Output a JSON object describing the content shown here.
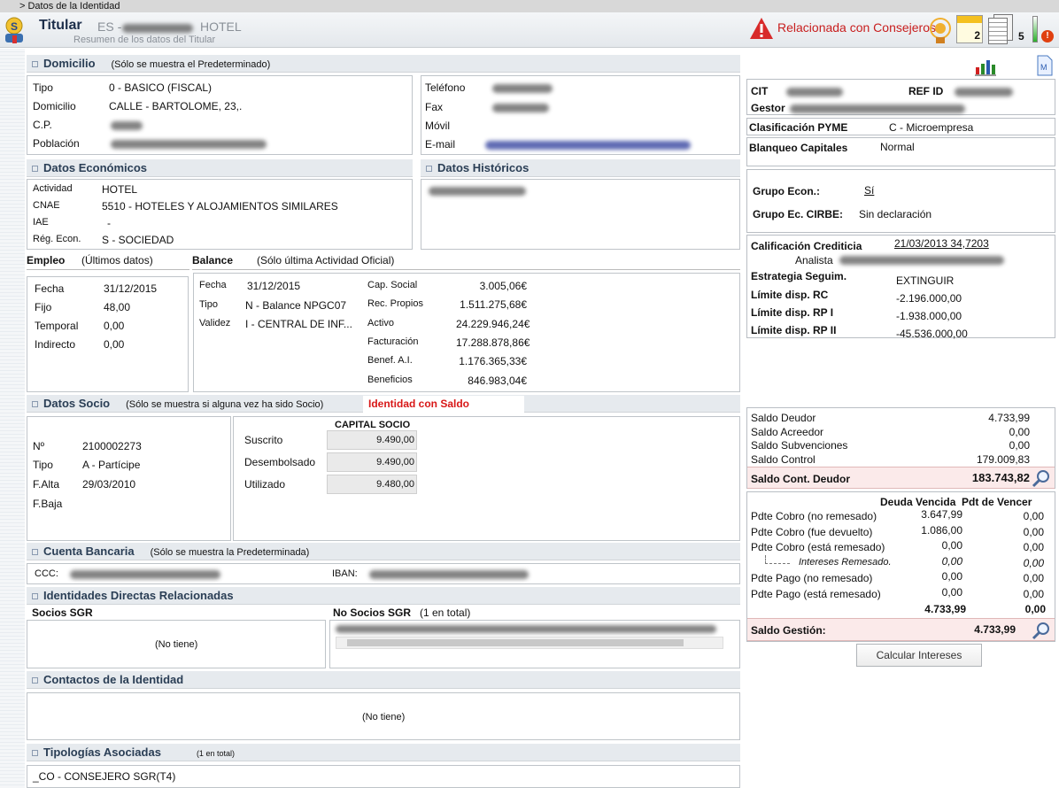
{
  "breadcrumb": "> Datos de la Identidad",
  "header": {
    "title": "Titular",
    "id_prefix": "ES -",
    "entity_name": "HOTEL",
    "subtitle": "Resumen de los datos del Titular",
    "alert_text": "Relacionada con Consejeros",
    "badge_notes": "2",
    "badge_docs": "5"
  },
  "domicilio": {
    "title": "Domicilio",
    "note": "(Sólo se muestra el Predeterminado)",
    "tipo_label": "Tipo",
    "tipo_value": "0 - BASICO (FISCAL)",
    "dom_label": "Domicilio",
    "dom_value": "CALLE - BARTOLOME, 23,.",
    "cp_label": "C.P.",
    "pob_label": "Población",
    "tel_label": "Teléfono",
    "fax_label": "Fax",
    "movil_label": "Móvil",
    "email_label": "E-mail"
  },
  "economicos": {
    "title": "Datos Económicos",
    "actividad_label": "Actividad",
    "actividad_value": "HOTEL",
    "cnae_label": "CNAE",
    "cnae_value": "5510 - HOTELES Y ALOJAMIENTOS SIMILARES",
    "iae_label": "IAE",
    "iae_value": "-",
    "reg_label": "Rég. Econ.",
    "reg_value": "S - SOCIEDAD"
  },
  "historicos": {
    "title": "Datos Históricos"
  },
  "empleo": {
    "title": "Empleo",
    "note": "(Últimos datos)",
    "rows": [
      {
        "label": "Fecha",
        "value": "31/12/2015"
      },
      {
        "label": "Fijo",
        "value": "48,00"
      },
      {
        "label": "Temporal",
        "value": "0,00"
      },
      {
        "label": "Indirecto",
        "value": "0,00"
      }
    ]
  },
  "balance": {
    "title": "Balance",
    "note": "(Sólo última Actividad Oficial)",
    "fecha_label": "Fecha",
    "fecha_value": "31/12/2015",
    "tipo_label": "Tipo",
    "tipo_value": "N - Balance NPGC07",
    "validez_label": "Validez",
    "validez_value": "I - CENTRAL DE INF...",
    "rows": [
      {
        "label": "Cap. Social",
        "value": "3.005,06€"
      },
      {
        "label": "Rec. Propios",
        "value": "1.511.275,68€"
      },
      {
        "label": "Activo",
        "value": "24.229.946,24€"
      },
      {
        "label": "Facturación",
        "value": "17.288.878,86€"
      },
      {
        "label": "Benef. A.I.",
        "value": "1.176.365,33€"
      },
      {
        "label": "Beneficios",
        "value": "846.983,04€"
      }
    ]
  },
  "socio": {
    "title": "Datos Socio",
    "note": "(Sólo se muestra si alguna vez ha sido Socio)",
    "blocked": "Identidad con Saldo Bloqueado",
    "num_label": "Nº",
    "num_value": "2100002273",
    "tipo_label": "Tipo",
    "tipo_value": "A - Partícipe",
    "alta_label": "F.Alta",
    "alta_value": "29/03/2010",
    "baja_label": "F.Baja",
    "capital_title": "CAPITAL SOCIO",
    "capital": [
      {
        "label": "Suscrito",
        "value": "9.490,00"
      },
      {
        "label": "Desembolsado",
        "value": "9.490,00"
      },
      {
        "label": "Utilizado",
        "value": "9.480,00"
      }
    ]
  },
  "cuenta": {
    "title": "Cuenta Bancaria",
    "note": "(Sólo se muestra la Predeterminada)",
    "ccc_label": "CCC:",
    "iban_label": "IBAN:"
  },
  "relacionadas": {
    "title": "Identidades Directas Relacionadas",
    "socios_label": "Socios SGR",
    "socios_empty": "(No tiene)",
    "nosocios_label": "No Socios SGR",
    "nosocios_count": "(1 en total)"
  },
  "contactos": {
    "title": "Contactos de la Identidad",
    "empty": "(No tiene)"
  },
  "tipologias": {
    "title": "Tipologías Asociadas",
    "count": "(1 en total)",
    "item": "_CO - CONSEJERO SGR(T4)"
  },
  "right": {
    "cit_label": "CIT",
    "refid_label": "REF ID",
    "gestor_label": "Gestor",
    "pyme_label": "Clasificación PYME",
    "pyme_value": "C - Microempresa",
    "blanqueo_label": "Blanqueo Capitales",
    "blanqueo_value": "Normal",
    "grupo_label": "Grupo Econ.:",
    "grupo_value": "Sí",
    "cirbe_label": "Grupo Ec. CIRBE:",
    "cirbe_value": "Sin declaración",
    "calif_label": "Calificación Crediticia",
    "calif_value": "21/03/2013  34,7203",
    "analista_label": "Analista",
    "estrategia_label": "Estrategia Seguim.",
    "estrategia_value": "EXTINGUIR",
    "limites": [
      {
        "label": "Límite disp. RC",
        "value": "-2.196.000,00"
      },
      {
        "label": "Límite disp. RP I",
        "value": "-1.938.000,00"
      },
      {
        "label": "Límite disp. RP II",
        "value": "-45.536.000,00"
      }
    ],
    "saldos": [
      {
        "label": "Saldo Deudor",
        "value": "4.733,99"
      },
      {
        "label": "Saldo Acreedor",
        "value": "0,00"
      },
      {
        "label": "Saldo Subvenciones",
        "value": "0,00"
      },
      {
        "label": "Saldo Control",
        "value": "179.009,83"
      }
    ],
    "cont_label": "Saldo Cont. Deudor",
    "cont_value": "183.743,82",
    "deuda_header": "Deuda Vencida",
    "pdt_header": "Pdt de Vencer",
    "deuda_rows": [
      {
        "label": "Pdte Cobro (no remesado)",
        "v1": "3.647,99",
        "v2": "0,00"
      },
      {
        "label": "Pdte Cobro (fue devuelto)",
        "v1": "1.086,00",
        "v2": "0,00"
      },
      {
        "label": "Pdte Cobro  (está remesado)",
        "v1": "0,00",
        "v2": "0,00"
      },
      {
        "label": "Intereses Remesado.",
        "v1": "0,00",
        "v2": "0,00"
      },
      {
        "label": "Pdte Pago (no remesado)",
        "v1": "0,00",
        "v2": "0,00"
      },
      {
        "label": "Pdte Pago  (está remesado)",
        "v1": "0,00",
        "v2": "0,00"
      }
    ],
    "total_v1": "4.733,99",
    "total_v2": "0,00",
    "gestion_label": "Saldo Gestión:",
    "gestion_value": "4.733,99",
    "calc_button": "Calcular Intereses"
  }
}
